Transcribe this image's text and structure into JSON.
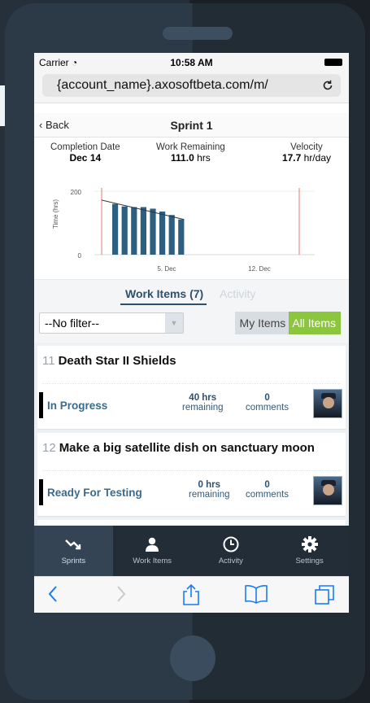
{
  "status_bar": {
    "carrier": "Carrier",
    "time": "10:58 AM"
  },
  "browser": {
    "url": "{account_name}.axosoftbeta.com/m/"
  },
  "nav": {
    "back_label": "Back",
    "title": "Sprint 1"
  },
  "stats": {
    "completion": {
      "label": "Completion Date",
      "value": "Dec 14"
    },
    "remaining": {
      "label": "Work Remaining",
      "value": "111.0",
      "unit": "hrs"
    },
    "velocity": {
      "label": "Velocity",
      "value": "17.7",
      "unit": "hr/day"
    }
  },
  "chart_data": {
    "type": "bar",
    "ylabel": "Time (hrs)",
    "yticks": [
      "200",
      "0"
    ],
    "ylim": [
      0,
      200
    ],
    "xtick_labels": [
      "5. Dec",
      "12. Dec"
    ],
    "values": [
      160,
      152,
      150,
      150,
      145,
      136,
      125,
      111
    ],
    "trend_line": {
      "start": 172,
      "end": 111
    },
    "marker_lines": [
      "sprint-start",
      "sprint-end"
    ],
    "colors": {
      "bars": "#2d5f80",
      "trend": "#333333",
      "markers": "#e07a7a"
    }
  },
  "tabs": {
    "work_items": "Work Items (7)",
    "activity": "Activity"
  },
  "filter": {
    "selected": "--No filter--",
    "my_items": "My Items",
    "all_items": "All Items"
  },
  "work_items": [
    {
      "number": "11",
      "title": "Death Star II Shields",
      "status": "In Progress",
      "hours": "40 hrs",
      "hours_label": "remaining",
      "comments": "0",
      "comments_label": "comments"
    },
    {
      "number": "12",
      "title": "Make a big satellite dish on sanctuary moon",
      "status": "Ready For Testing",
      "hours": "0 hrs",
      "hours_label": "remaining",
      "comments": "0",
      "comments_label": "comments"
    }
  ],
  "bottom_tabs": [
    {
      "label": "Sprints",
      "icon": "sprints-icon",
      "active": true
    },
    {
      "label": "Work Items",
      "icon": "user-icon",
      "active": false
    },
    {
      "label": "Activity",
      "icon": "clock-icon",
      "active": false
    },
    {
      "label": "Settings",
      "icon": "gear-icon",
      "active": false
    }
  ],
  "colors": {
    "accent_green": "#8cc63f",
    "navy": "#2f4f6b",
    "tabbar": "#232d38"
  }
}
